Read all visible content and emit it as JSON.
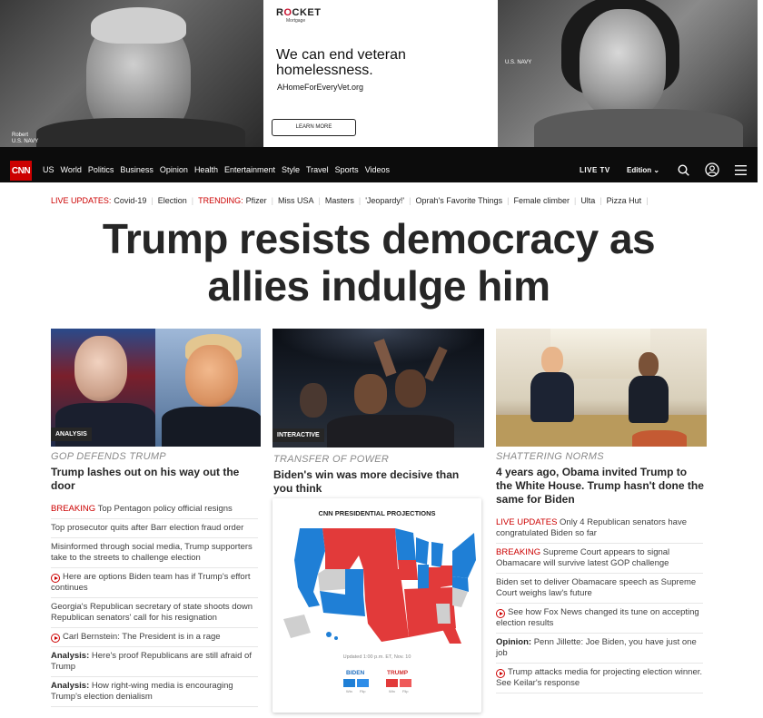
{
  "ad": {
    "brand": "RCKET",
    "brand_o": "O",
    "sub": "Mortgage",
    "headline": "We can end veteran homelessness.",
    "url": "AHomeForEveryVet.org",
    "button": "LEARN MORE",
    "left_vet": "Robert\nU.S. NAVY",
    "right_vet": "U.S. NAVY"
  },
  "nav": {
    "logo": "CNN",
    "links": [
      "US",
      "World",
      "Politics",
      "Business",
      "Opinion",
      "Health",
      "Entertainment",
      "Style",
      "Travel",
      "Sports",
      "Videos"
    ],
    "live_tv": "LIVE TV",
    "edition": "Edition"
  },
  "trending": {
    "live_updates_label": "LIVE UPDATES:",
    "live_updates_topic": "Covid-19",
    "election": "Election",
    "trending_label": "TRENDING:",
    "topics": [
      "Pfizer",
      "Miss USA",
      "Masters",
      "'Jeopardy!'",
      "Oprah's Favorite Things",
      "Female climber",
      "Ulta",
      "Pizza Hut"
    ]
  },
  "headline": "Trump resists democracy as allies indulge him",
  "col1": {
    "tag": "ANALYSIS",
    "kicker": "GOP DEFENDS TRUMP",
    "title": "Trump lashes out on his way out the door",
    "items": [
      {
        "prefix": "BREAKING",
        "text": "Top Pentagon policy official resigns"
      },
      {
        "text": "Top prosecutor quits after Barr election fraud order"
      },
      {
        "text": "Misinformed through social media, Trump supporters take to the streets to challenge election"
      },
      {
        "video": true,
        "text": "Here are options Biden team has if Trump's effort continues"
      },
      {
        "text": "Georgia's Republican secretary of state shoots down Republican senators' call for his resignation"
      },
      {
        "video": true,
        "text": "Carl Bernstein: The President is in a rage"
      },
      {
        "bold": "Analysis:",
        "text": "Here's proof Republicans are still afraid of Trump"
      },
      {
        "bold": "Analysis:",
        "text": "How right-wing media is encouraging Trump's election denialism"
      }
    ]
  },
  "col2": {
    "tag": "INTERACTIVE",
    "kicker": "TRANSFER OF POWER",
    "title": "Biden's win was more decisive than you think",
    "map_title": "CNN PRESIDENTIAL PROJECTIONS",
    "updated": "Updated 1:00 p.m. ET, Nov. 10",
    "biden": "BIDEN",
    "trump": "TRUMP",
    "win": "Win",
    "flip": "Flip",
    "colors": {
      "dem": "#1f7fd6",
      "rep": "#e23a3a",
      "undecided": "#cfcfcf"
    }
  },
  "col3": {
    "kicker": "SHATTERING NORMS",
    "title": "4 years ago, Obama invited Trump to the White House. Trump hasn't done the same for Biden",
    "items": [
      {
        "prefix": "LIVE UPDATES",
        "text": "Only 4 Republican senators have congratulated Biden so far"
      },
      {
        "prefix": "BREAKING",
        "text": "Supreme Court appears to signal Obamacare will survive latest GOP challenge"
      },
      {
        "text": "Biden set to deliver Obamacare speech as Supreme Court weighs law's future"
      },
      {
        "video": true,
        "text": "See how Fox News changed its tune on accepting election results"
      },
      {
        "bold": "Opinion:",
        "text": "Penn Jillette: Joe Biden, you have just one job"
      },
      {
        "video": true,
        "text": "Trump attacks media for projecting election winner. See Keilar's response"
      }
    ]
  }
}
